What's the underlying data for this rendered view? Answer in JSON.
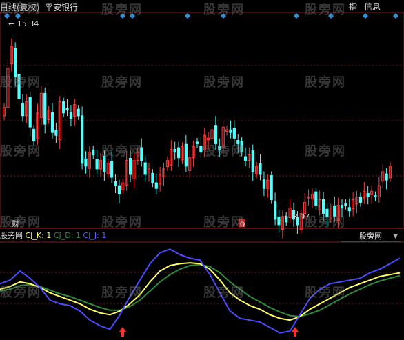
{
  "header": {
    "title": "日线(复权)",
    "stock_name": "平安银行",
    "buttons": [
      "指",
      "信息"
    ]
  },
  "indicator": {
    "name": "股旁网",
    "k_label": "CJ_K: 1",
    "d_label": "CJ_D: 1",
    "j_label": "CJ_J: 1",
    "dropdown": "股旁网"
  },
  "markers": {
    "cai": "财",
    "q": "Q"
  },
  "watermark": "股旁网",
  "colors": {
    "up": "#ff3c3c",
    "down": "#54ffff",
    "k": "#ffff66",
    "d": "#2e8b3e",
    "j": "#4b4bff",
    "grid": "#7a1e1e",
    "diamond": "#2f8fd8"
  },
  "chart_data": {
    "type": "candlestick",
    "price_high_label": "15.34",
    "price_low_label": "8.97",
    "price_range": [
      8.5,
      16.0
    ],
    "closes": [
      12.8,
      14.2,
      15.0,
      13.9,
      13.1,
      12.5,
      13.0,
      12.1,
      11.6,
      12.6,
      13.3,
      12.2,
      12.7,
      11.9,
      11.8,
      13.0,
      12.6,
      12.7,
      12.4,
      12.9,
      12.5,
      10.8,
      10.7,
      11.2,
      11.1,
      10.6,
      10.9,
      10.5,
      10.8,
      10.3,
      10.0,
      9.7,
      10.1,
      10.9,
      10.4,
      10.9,
      11.2,
      10.9,
      10.4,
      10.6,
      10.1,
      9.9,
      10.4,
      10.6,
      10.9,
      11.3,
      11.2,
      11.0,
      11.4,
      10.7,
      11.0,
      11.4,
      11.5,
      11.2,
      11.8,
      11.7,
      12.0,
      11.5,
      11.3,
      12.1,
      12.0,
      11.9,
      11.7,
      11.5,
      11.2,
      10.9,
      11.1,
      10.5,
      10.7,
      10.4,
      9.9,
      10.2,
      9.5,
      8.8,
      8.6,
      8.9,
      8.7,
      9.2,
      8.8,
      8.6,
      9.0,
      9.4,
      9.6,
      9.7,
      9.3,
      9.5,
      9.0,
      8.9,
      9.2,
      8.9,
      9.3,
      9.2,
      9.3,
      9.1,
      9.5,
      9.6,
      9.4,
      9.8,
      9.6,
      9.8,
      9.6,
      10.0,
      10.5,
      10.2,
      10.7
    ],
    "kdj": {
      "K": [
        52,
        55,
        60,
        58,
        54,
        48,
        44,
        40,
        36,
        30,
        26,
        24,
        28,
        36,
        46,
        60,
        72,
        78,
        80,
        81,
        80,
        74,
        62,
        48,
        40,
        34,
        30,
        24,
        20,
        18,
        22,
        30,
        36,
        42,
        48,
        54,
        58,
        62,
        66,
        68,
        70
      ],
      "D": [
        50,
        52,
        56,
        57,
        55,
        51,
        47,
        44,
        40,
        36,
        32,
        29,
        29,
        33,
        40,
        50,
        60,
        68,
        74,
        78,
        79,
        77,
        70,
        60,
        52,
        44,
        38,
        32,
        27,
        23,
        22,
        25,
        29,
        35,
        41,
        47,
        52,
        57,
        61,
        64,
        67
      ],
      "J": [
        58,
        62,
        72,
        64,
        54,
        40,
        36,
        34,
        28,
        18,
        12,
        8,
        24,
        44,
        62,
        80,
        92,
        96,
        90,
        86,
        84,
        68,
        48,
        28,
        20,
        18,
        16,
        10,
        4,
        6,
        24,
        42,
        52,
        58,
        60,
        62,
        64,
        70,
        74,
        80,
        86
      ]
    }
  }
}
